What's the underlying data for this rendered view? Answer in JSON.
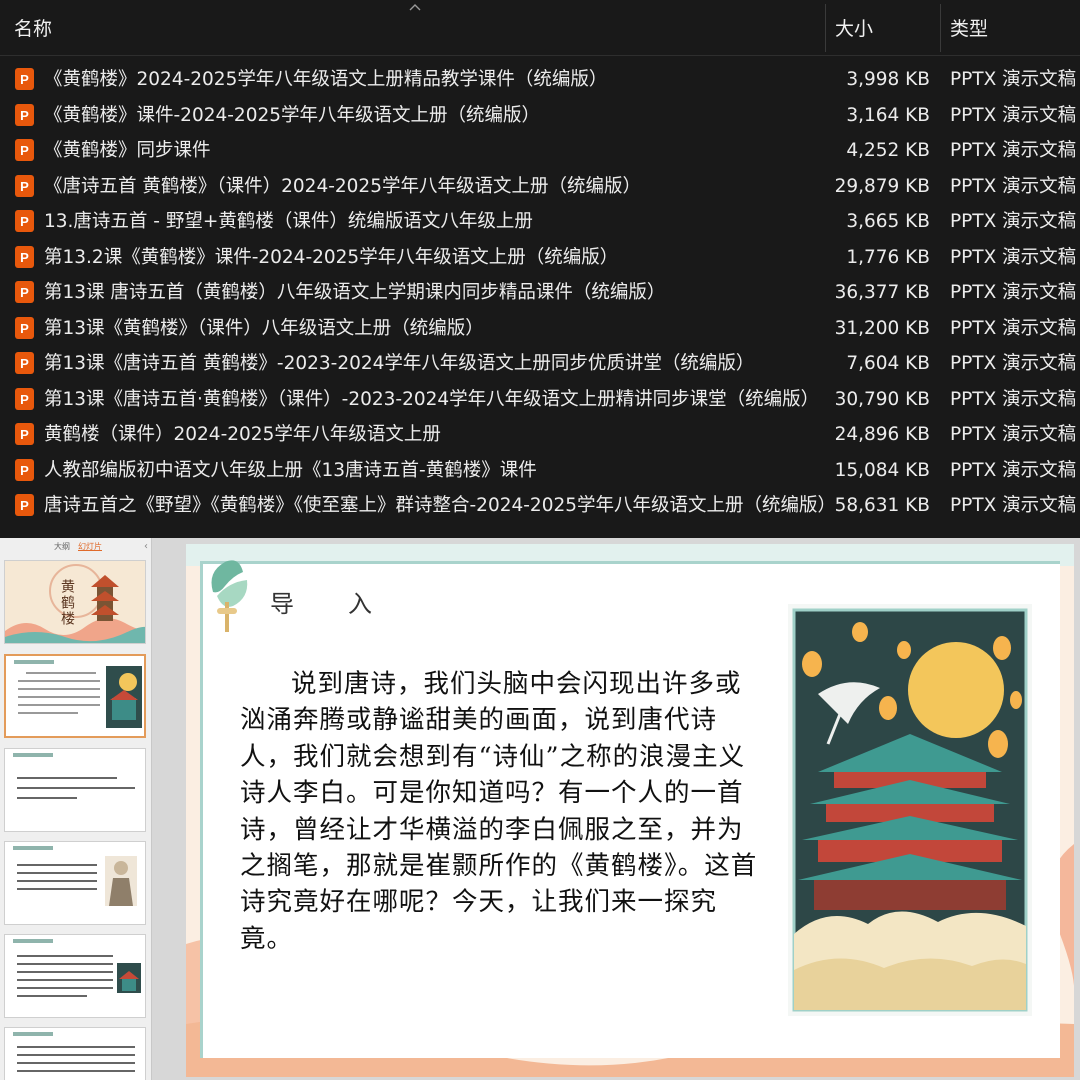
{
  "explorer": {
    "columns": {
      "name": "名称",
      "size": "大小",
      "type": "类型"
    },
    "file_icon": "pptx-file-icon",
    "accent_color": "#e8580c",
    "files": [
      {
        "name": "《黄鹤楼》2024-2025学年八年级语文上册精品教学课件（统编版）",
        "size": "3,998 KB",
        "type": "PPTX 演示文稿"
      },
      {
        "name": "《黄鹤楼》课件-2024-2025学年八年级语文上册（统编版）",
        "size": "3,164 KB",
        "type": "PPTX 演示文稿"
      },
      {
        "name": "《黄鹤楼》同步课件",
        "size": "4,252 KB",
        "type": "PPTX 演示文稿"
      },
      {
        "name": "《唐诗五首 黄鹤楼》（课件）2024-2025学年八年级语文上册（统编版）",
        "size": "29,879 KB",
        "type": "PPTX 演示文稿"
      },
      {
        "name": "13.唐诗五首 - 野望+黄鹤楼（课件）统编版语文八年级上册",
        "size": "3,665 KB",
        "type": "PPTX 演示文稿"
      },
      {
        "name": "第13.2课《黄鹤楼》课件-2024-2025学年八年级语文上册（统编版）",
        "size": "1,776 KB",
        "type": "PPTX 演示文稿"
      },
      {
        "name": "第13课 唐诗五首（黄鹤楼）八年级语文上学期课内同步精品课件（统编版）",
        "size": "36,377 KB",
        "type": "PPTX 演示文稿"
      },
      {
        "name": "第13课《黄鹤楼》（课件）八年级语文上册（统编版）",
        "size": "31,200 KB",
        "type": "PPTX 演示文稿"
      },
      {
        "name": "第13课《唐诗五首 黄鹤楼》-2023-2024学年八年级语文上册同步优质讲堂（统编版）",
        "size": "7,604 KB",
        "type": "PPTX 演示文稿"
      },
      {
        "name": "第13课《唐诗五首·黄鹤楼》（课件）-2023-2024学年八年级语文上册精讲同步课堂（统编版）",
        "size": "30,790 KB",
        "type": "PPTX 演示文稿"
      },
      {
        "name": "黄鹤楼（课件）2024-2025学年八年级语文上册",
        "size": "24,896 KB",
        "type": "PPTX 演示文稿"
      },
      {
        "name": "人教部编版初中语文八年级上册《13唐诗五首-黄鹤楼》课件",
        "size": "15,084 KB",
        "type": "PPTX 演示文稿"
      },
      {
        "name": "唐诗五首之《野望》《黄鹤楼》《使至塞上》群诗整合-2024-2025学年八年级语文上册（统编版）",
        "size": "58,631 KB",
        "type": "PPTX 演示文稿"
      }
    ]
  },
  "ppt": {
    "outline_tab": "大纲",
    "slides_tab": "幻灯片",
    "thumb1_title": "黄鹤楼",
    "slide": {
      "title_a": "导",
      "title_b": "入",
      "body": "说到唐诗，我们头脑中会闪现出许多或汹涌奔腾或静谧甜美的画面，说到唐代诗人，我们就会想到有“诗仙”之称的浪漫主义诗人李白。可是你知道吗？有一个人的一首诗，曾经让才华横溢的李白佩服之至，并为之搁笔，那就是崔颢所作的《黄鹤楼》。这首诗究竟好在哪呢？今天，让我们来一探究竟。"
    }
  }
}
